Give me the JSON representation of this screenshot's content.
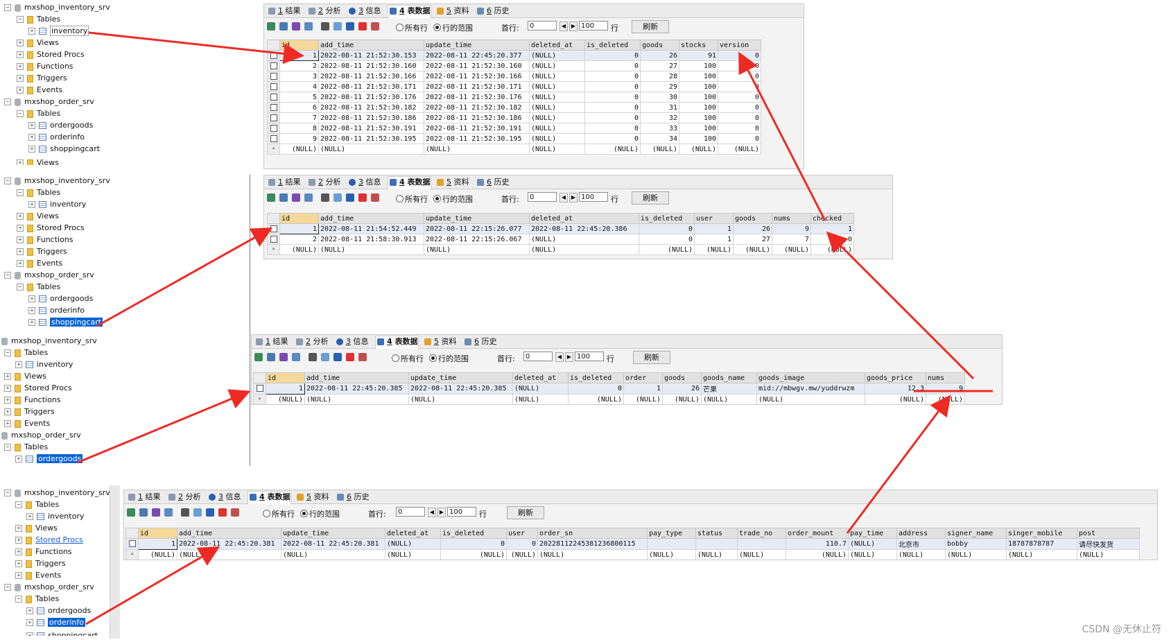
{
  "colors": {
    "arrow": "#ee2a24",
    "selected": "#0a64d4",
    "header_id": "#f5d89a"
  },
  "tabs": [
    {
      "num": "1",
      "label": "结果",
      "icon": "results-icon"
    },
    {
      "num": "2",
      "label": "分析",
      "icon": "profiler-icon"
    },
    {
      "num": "3",
      "label": "信息",
      "icon": "info-icon"
    },
    {
      "num": "4",
      "label": "表数据",
      "icon": "table-data-icon"
    },
    {
      "num": "5",
      "label": "资料",
      "icon": "info-chart-icon"
    },
    {
      "num": "6",
      "label": "历史",
      "icon": "history-icon"
    }
  ],
  "toolbar": {
    "all_rows": "所有行",
    "row_range": "行的范围",
    "first_row_label": "首行:",
    "first_row_value": "0",
    "row_count_value": "100",
    "rows_label": "行",
    "refresh": "刷新"
  },
  "tree": {
    "db_inventory": "mxshop_inventory_srv",
    "db_order": "mxshop_order_srv",
    "tables": "Tables",
    "views": "Views",
    "stored_procs": "Stored Procs",
    "functions": "Functions",
    "triggers": "Triggers",
    "events": "Events",
    "inventory": "inventory",
    "ordergoods": "ordergoods",
    "orderinfo": "orderinfo",
    "shoppingcart": "shoppingcart",
    "views_cut": "Views",
    "shoppingcart_cut": "shoppingcart"
  },
  "grid1": {
    "columns": [
      "id",
      "add_time",
      "update_time",
      "deleted_at",
      "is_deleted",
      "goods",
      "stocks",
      "version"
    ],
    "rows": [
      [
        "1",
        "2022-08-11 21:52:30.153",
        "2022-08-11 22:45:20.377",
        "(NULL)",
        "0",
        "26",
        "91",
        "0"
      ],
      [
        "2",
        "2022-08-11 21:52:30.160",
        "2022-08-11 21:52:30.160",
        "(NULL)",
        "0",
        "27",
        "100",
        "0"
      ],
      [
        "3",
        "2022-08-11 21:52:30.166",
        "2022-08-11 21:52:30.166",
        "(NULL)",
        "0",
        "28",
        "100",
        "0"
      ],
      [
        "4",
        "2022-08-11 21:52:30.171",
        "2022-08-11 21:52:30.171",
        "(NULL)",
        "0",
        "29",
        "100",
        "0"
      ],
      [
        "5",
        "2022-08-11 21:52:30.176",
        "2022-08-11 21:52:30.176",
        "(NULL)",
        "0",
        "30",
        "100",
        "0"
      ],
      [
        "6",
        "2022-08-11 21:52:30.182",
        "2022-08-11 21:52:30.182",
        "(NULL)",
        "0",
        "31",
        "100",
        "0"
      ],
      [
        "7",
        "2022-08-11 21:52:30.186",
        "2022-08-11 21:52:30.186",
        "(NULL)",
        "0",
        "32",
        "100",
        "0"
      ],
      [
        "8",
        "2022-08-11 21:52:30.191",
        "2022-08-11 21:52:30.191",
        "(NULL)",
        "0",
        "33",
        "100",
        "0"
      ],
      [
        "9",
        "2022-08-11 21:52:30.195",
        "2022-08-11 21:52:30.195",
        "(NULL)",
        "0",
        "34",
        "100",
        "0"
      ]
    ],
    "null_row": [
      "(NULL)",
      "(NULL)",
      "(NULL)",
      "(NULL)",
      "(NULL)",
      "(NULL)",
      "(NULL)",
      "(NULL)"
    ]
  },
  "grid2": {
    "columns": [
      "id",
      "add_time",
      "update_time",
      "deleted_at",
      "is_deleted",
      "user",
      "goods",
      "nums",
      "checked"
    ],
    "rows": [
      [
        "1",
        "2022-08-11 21:54:52.449",
        "2022-08-11 22:15:26.077",
        "2022-08-11 22:45:20.386",
        "0",
        "1",
        "26",
        "9",
        "1"
      ],
      [
        "2",
        "2022-08-11 21:58:30.913",
        "2022-08-11 22:15:26.067",
        "(NULL)",
        "0",
        "1",
        "27",
        "7",
        "0"
      ]
    ],
    "null_row": [
      "(NULL)",
      "(NULL)",
      "(NULL)",
      "(NULL)",
      "(NULL)",
      "(NULL)",
      "(NULL)",
      "(NULL)",
      "(NULL)"
    ]
  },
  "grid3": {
    "columns": [
      "id",
      "add_time",
      "update_time",
      "deleted_at",
      "is_deleted",
      "order",
      "goods",
      "goods_name",
      "goods_image",
      "goods_price",
      "nums"
    ],
    "rows": [
      [
        "1",
        "2022-08-11 22:45:20.385",
        "2022-08-11 22:45:20.385",
        "(NULL)",
        "0",
        "1",
        "26",
        "芒果",
        "mid://mbwgv.mw/yuddrwzm",
        "12.3",
        "9"
      ]
    ],
    "null_row": [
      "(NULL)",
      "(NULL)",
      "(NULL)",
      "(NULL)",
      "(NULL)",
      "(NULL)",
      "(NULL)",
      "(NULL)",
      "(NULL)",
      "(NULL)",
      "(NULL)"
    ]
  },
  "grid4": {
    "columns": [
      "id",
      "add_time",
      "update_time",
      "deleted_at",
      "is_deleted",
      "user",
      "order_sn",
      "pay_type",
      "status",
      "trade_no",
      "order_mount",
      "pay_time",
      "address",
      "signer_name",
      "singer_mobile",
      "post"
    ],
    "rows": [
      [
        "1",
        "2022-08-11 22:45:20.381",
        "2022-08-11 22:45:20.381",
        "(NULL)",
        "0",
        "0",
        "20228112245381236800115",
        "",
        "",
        "",
        "110.7",
        "(NULL)",
        "北京市",
        "bobby",
        "18787878787",
        "请尽快发货"
      ]
    ],
    "null_row": [
      "(NULL)",
      "(NULL)",
      "(NULL)",
      "(NULL)",
      "(NULL)",
      "(NULL)",
      "(NULL)",
      "(NULL)",
      "(NULL)",
      "(NULL)",
      "(NULL)",
      "(NULL)",
      "(NULL)",
      "(NULL)",
      "(NULL)",
      "(NULL)"
    ]
  },
  "watermark": "CSDN @无休止符"
}
